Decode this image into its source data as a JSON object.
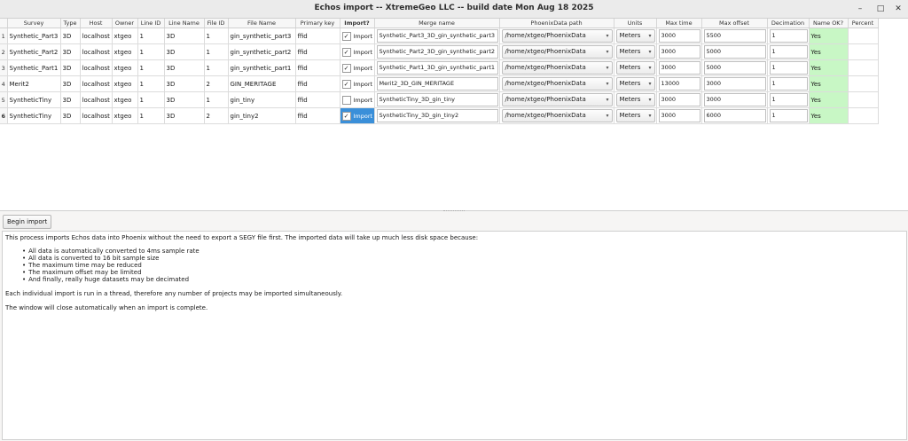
{
  "window": {
    "title": "Echos import -- XtremeGeo LLC -- build date Mon Aug 18 2025",
    "minimize": "–",
    "maximize": "□",
    "close": "✕"
  },
  "table": {
    "columns": [
      "Survey",
      "Type",
      "Host",
      "Owner",
      "Line ID",
      "Line Name",
      "File ID",
      "File Name",
      "Primary key",
      "Import?",
      "Merge name",
      "PhoenixData path",
      "Units",
      "Max time",
      "Max offset",
      "Decimation",
      "Name OK?",
      "Percent"
    ],
    "rows": [
      {
        "num": "1",
        "survey": "Synthetic_Part3",
        "type": "3D",
        "host": "localhost",
        "owner": "xtgeo",
        "line_id": "1",
        "line_name": "3D",
        "file_id": "1",
        "file_name": "gin_synthetic_part3",
        "primary_key": "ffid",
        "import_checked": true,
        "import_label": "Import",
        "merge_name": "Synthetic_Part3_3D_gin_synthetic_part3",
        "path": "/home/xtgeo/PhoenixData",
        "units": "Meters",
        "max_time": "3000",
        "max_offset": "5500",
        "decimation": "1",
        "name_ok": "Yes",
        "percent": ""
      },
      {
        "num": "2",
        "survey": "Synthetic_Part2",
        "type": "3D",
        "host": "localhost",
        "owner": "xtgeo",
        "line_id": "1",
        "line_name": "3D",
        "file_id": "1",
        "file_name": "gin_synthetic_part2",
        "primary_key": "ffid",
        "import_checked": true,
        "import_label": "Import",
        "merge_name": "Synthetic_Part2_3D_gin_synthetic_part2",
        "path": "/home/xtgeo/PhoenixData",
        "units": "Meters",
        "max_time": "3000",
        "max_offset": "5000",
        "decimation": "1",
        "name_ok": "Yes",
        "percent": ""
      },
      {
        "num": "3",
        "survey": "Synthetic_Part1",
        "type": "3D",
        "host": "localhost",
        "owner": "xtgeo",
        "line_id": "1",
        "line_name": "3D",
        "file_id": "1",
        "file_name": "gin_synthetic_part1",
        "primary_key": "ffid",
        "import_checked": true,
        "import_label": "Import",
        "merge_name": "Synthetic_Part1_3D_gin_synthetic_part1",
        "path": "/home/xtgeo/PhoenixData",
        "units": "Meters",
        "max_time": "3000",
        "max_offset": "5000",
        "decimation": "1",
        "name_ok": "Yes",
        "percent": ""
      },
      {
        "num": "4",
        "survey": "Merit2",
        "type": "3D",
        "host": "localhost",
        "owner": "xtgeo",
        "line_id": "1",
        "line_name": "3D",
        "file_id": "2",
        "file_name": "GIN_MERITAGE",
        "primary_key": "ffid",
        "import_checked": true,
        "import_label": "Import",
        "merge_name": "Merit2_3D_GIN_MERITAGE",
        "path": "/home/xtgeo/PhoenixData",
        "units": "Meters",
        "max_time": "13000",
        "max_offset": "3000",
        "decimation": "1",
        "name_ok": "Yes",
        "percent": ""
      },
      {
        "num": "5",
        "survey": "SyntheticTiny",
        "type": "3D",
        "host": "localhost",
        "owner": "xtgeo",
        "line_id": "1",
        "line_name": "3D",
        "file_id": "1",
        "file_name": "gin_tiny",
        "primary_key": "ffid",
        "import_checked": false,
        "import_label": "Import",
        "merge_name": "SyntheticTiny_3D_gin_tiny",
        "path": "/home/xtgeo/PhoenixData",
        "units": "Meters",
        "max_time": "3000",
        "max_offset": "3000",
        "decimation": "1",
        "name_ok": "Yes",
        "percent": ""
      },
      {
        "num": "6",
        "survey": "SyntheticTiny",
        "type": "3D",
        "host": "localhost",
        "owner": "xtgeo",
        "line_id": "1",
        "line_name": "3D",
        "file_id": "2",
        "file_name": "gin_tiny2",
        "primary_key": "ffid",
        "import_checked": true,
        "import_label": "Import",
        "merge_name": "SyntheticTiny_3D_gin_tiny2",
        "path": "/home/xtgeo/PhoenixData",
        "units": "Meters",
        "max_time": "3000",
        "max_offset": "6000",
        "decimation": "1",
        "name_ok": "Yes",
        "percent": ""
      }
    ],
    "selected_row": 5
  },
  "begin_button": "Begin import",
  "info": {
    "intro": "This process imports Echos data into Phoenix without the need to export a SEGY file first. The imported data will take up much less disk space because:",
    "bullets": [
      "All data is automatically converted to 4ms sample rate",
      "All data is converted to 16 bit sample size",
      "The maximum time may be reduced",
      "The maximum offset may be limited",
      "And finally, really huge datasets may be decimated"
    ],
    "threads": "Each individual import is run in a thread, therefore any number of projects may be imported simultaneously.",
    "close_note": "The window will close automatically when an import is complete."
  },
  "colors": {
    "selected_import": "#3a8fd9",
    "name_ok_bg": "#c8f7c5"
  }
}
